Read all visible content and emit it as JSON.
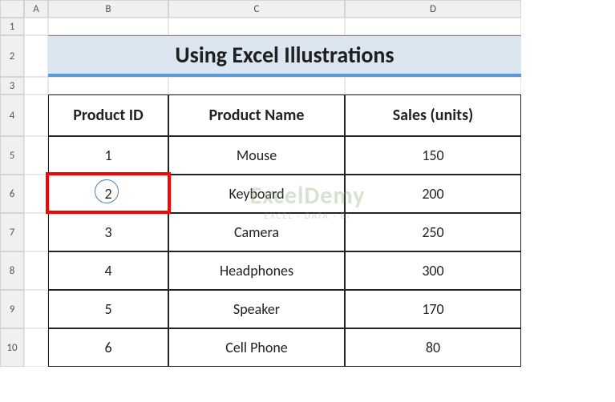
{
  "columns": [
    "A",
    "B",
    "C",
    "D"
  ],
  "rows": [
    "1",
    "2",
    "3",
    "4",
    "5",
    "6",
    "7",
    "8",
    "9",
    "10"
  ],
  "title": "Using Excel Illustrations",
  "headers": {
    "b": "Product ID",
    "c": "Product Name",
    "d": "Sales (units)"
  },
  "data": [
    {
      "id": "1",
      "name": "Mouse",
      "sales": "150"
    },
    {
      "id": "2",
      "name": "Keyboard",
      "sales": "200"
    },
    {
      "id": "3",
      "name": "Camera",
      "sales": "250"
    },
    {
      "id": "4",
      "name": "Headphones",
      "sales": "300"
    },
    {
      "id": "5",
      "name": "Speaker",
      "sales": "170"
    },
    {
      "id": "6",
      "name": "Cell Phone",
      "sales": "80"
    }
  ],
  "watermark": {
    "main": "ExcelDemy",
    "sub": "EXCEL · DATA · BI"
  }
}
